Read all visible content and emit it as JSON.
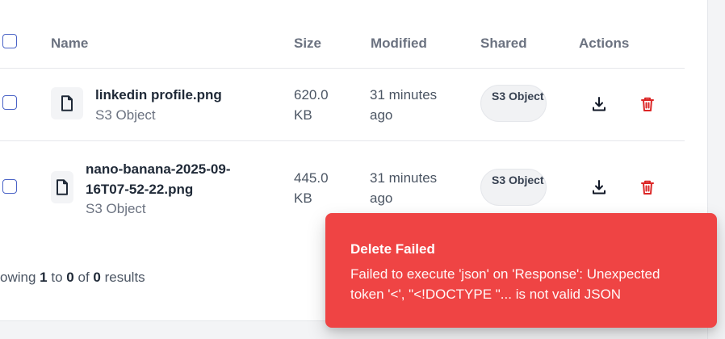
{
  "table": {
    "headers": {
      "name": "Name",
      "size": "Size",
      "modified": "Modified",
      "shared": "Shared",
      "actions": "Actions"
    },
    "rows": [
      {
        "name": "linkedin profile.png",
        "type": "S3 Object",
        "size": "620.0 KB",
        "modified": "31 minutes ago",
        "shared": "S3 Object",
        "icon": "file-icon"
      },
      {
        "name": "nano-banana-2025-09-16T07-52-22.png",
        "type": "S3 Object",
        "size": "445.0 KB",
        "modified": "31 minutes ago",
        "shared": "S3 Object",
        "icon": "file-icon"
      }
    ]
  },
  "pagination": {
    "prefix": "owing",
    "from": "1",
    "to_label": "to",
    "to": "0",
    "of_label": "of",
    "total": "0",
    "suffix": "results"
  },
  "toast": {
    "title": "Delete Failed",
    "message": "Failed to execute 'json' on 'Response': Unexpected token '<', \"<!DOCTYPE \"... is not valid JSON"
  },
  "colors": {
    "toast_bg": "#ef4444",
    "checkbox_border": "#4a63c6",
    "delete_icon": "#dc2626"
  },
  "icons": {
    "download": "download-icon",
    "delete": "trash-icon",
    "file": "file-icon"
  }
}
